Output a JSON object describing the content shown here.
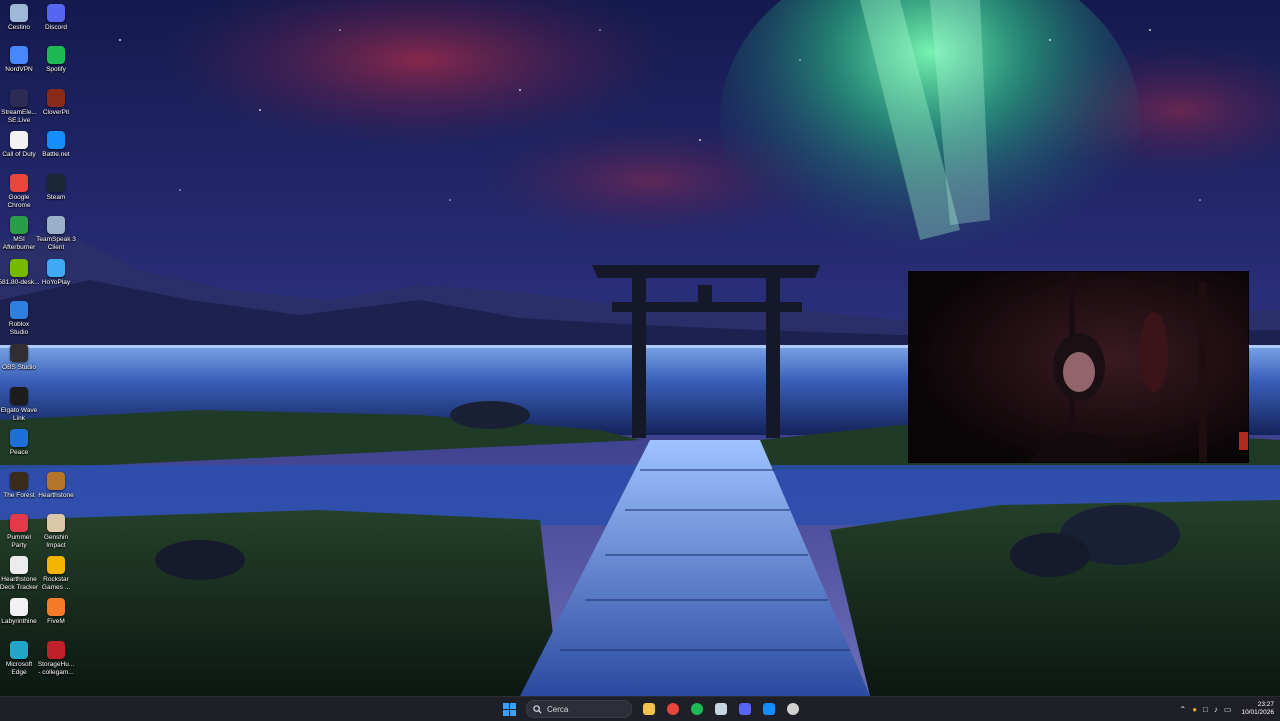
{
  "desktop": {
    "icons": [
      {
        "label": "Cestino",
        "icon": "recycle-bin-icon",
        "color": "#9fb8d8"
      },
      {
        "label": "Discord",
        "icon": "discord-icon",
        "color": "#5865f2"
      },
      {
        "label": "NordVPN",
        "icon": "nordvpn-icon",
        "color": "#4687ff"
      },
      {
        "label": "Spotify",
        "icon": "spotify-icon",
        "color": "#1db954"
      },
      {
        "label": "StreamEle...\nSE.Live",
        "icon": "streamelements-icon",
        "color": "#2b2b55"
      },
      {
        "label": "CloverPit",
        "icon": "cloverpit-icon",
        "color": "#8a2a1a"
      },
      {
        "label": "Call of Duty",
        "icon": "call-of-duty-icon",
        "color": "#f2f2f2"
      },
      {
        "label": "Battle.net",
        "icon": "battlenet-icon",
        "color": "#148eff"
      },
      {
        "label": "Google\nChrome",
        "icon": "chrome-icon",
        "color": "#e8453c"
      },
      {
        "label": "Steam",
        "icon": "steam-icon",
        "color": "#1b2838"
      },
      {
        "label": "MSI\nAfterburner",
        "icon": "msi-afterburner-icon",
        "color": "#2a9d4a"
      },
      {
        "label": "TeamSpeak 3\nClient",
        "icon": "teamspeak-icon",
        "color": "#9ab0c8"
      },
      {
        "label": "581.80-desk...",
        "icon": "nvidia-icon",
        "color": "#76b900"
      },
      {
        "label": "HoYoPlay",
        "icon": "hoyoplay-icon",
        "color": "#3fa9f5"
      },
      {
        "label": "Roblox\nStudio",
        "icon": "roblox-studio-icon",
        "color": "#2f7fe0"
      },
      {
        "label": "OBS Studio",
        "icon": "obs-icon",
        "color": "#302e31"
      },
      {
        "label": "Elgato Wave\nLink",
        "icon": "elgato-wave-link-icon",
        "color": "#1c1c1c"
      },
      {
        "label": "Peace",
        "icon": "peace-icon",
        "color": "#1e6fd9"
      },
      {
        "label": "The Forest",
        "icon": "the-forest-icon",
        "color": "#3a2a1a"
      },
      {
        "label": "Hearthstone",
        "icon": "hearthstone-icon",
        "color": "#b5762a"
      },
      {
        "label": "Pummel\nParty",
        "icon": "pummel-party-icon",
        "color": "#e23a4a"
      },
      {
        "label": "Genshin\nImpact",
        "icon": "genshin-impact-icon",
        "color": "#d9c7a8"
      },
      {
        "label": "Hearthstone\nDeck Tracker",
        "icon": "hdt-icon",
        "color": "#ececec"
      },
      {
        "label": "Rockstar\nGames ...",
        "icon": "rockstar-icon",
        "color": "#f5b400"
      },
      {
        "label": "Labyrinthine",
        "icon": "labyrinthine-icon",
        "color": "#f2f2f2"
      },
      {
        "label": "FiveM",
        "icon": "fivem-icon",
        "color": "#f47a2a"
      },
      {
        "label": "Microsoft\nEdge",
        "icon": "edge-icon",
        "color": "#1fa6c9"
      },
      {
        "label": "StorageHu...\n- collegam...",
        "icon": "storagehub-icon",
        "color": "#c0202a"
      }
    ]
  },
  "taskbar": {
    "start": {
      "icon": "windows-start-icon"
    },
    "search": {
      "placeholder": "Cerca",
      "icon": "search-icon"
    },
    "apps": [
      {
        "name": "file-explorer-icon",
        "color": "#f2c14e"
      },
      {
        "name": "chrome-icon",
        "color": "#e8453c"
      },
      {
        "name": "spotify-icon",
        "color": "#1db954"
      },
      {
        "name": "steam-icon",
        "color": "#c7d5e0"
      },
      {
        "name": "discord-icon",
        "color": "#5865f2"
      },
      {
        "name": "battlenet-icon",
        "color": "#148eff"
      },
      {
        "name": "obs-icon",
        "color": "#d0d0d0"
      }
    ],
    "tray": {
      "icons": [
        "chevron-up-icon",
        "microphone-icon",
        "network-icon",
        "volume-icon",
        "battery-icon"
      ],
      "time": "23:27",
      "date": "10/01/2026"
    }
  }
}
